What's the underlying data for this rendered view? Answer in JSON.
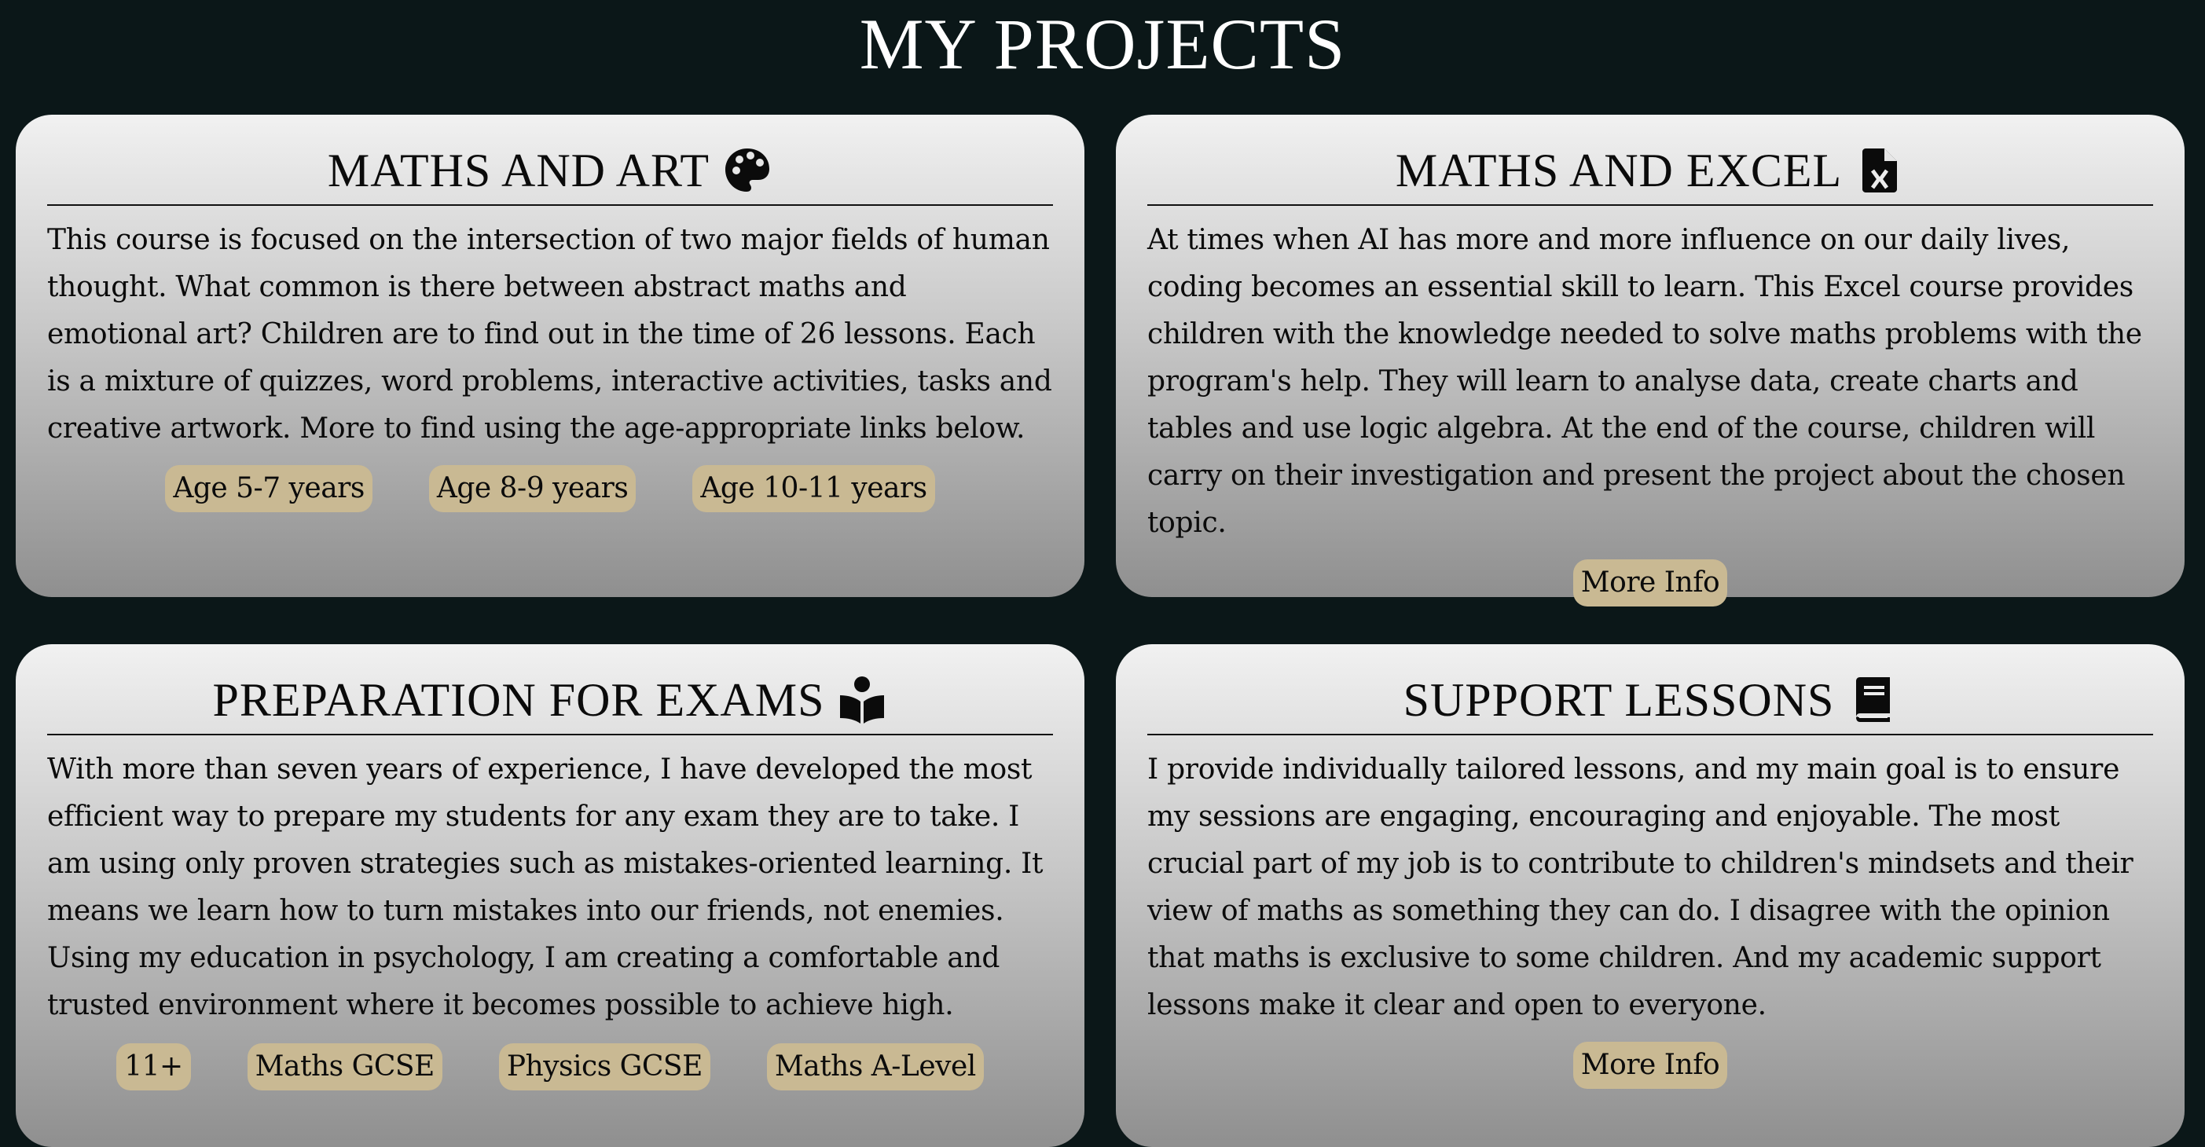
{
  "page": {
    "title": "MY PROJECTS"
  },
  "cards": [
    {
      "title": "MATHS AND ART",
      "icon": "palette-icon",
      "text": "This course is focused on the intersection of two major fields of human thought. What common is there between abstract maths and emotional art? Children are to find out in the time of 26 lessons. Each is a mixture of quizzes, word problems, interactive activities, tasks and creative artwork. More to find using the age-appropriate links below.",
      "buttons": [
        "Age 5-7 years",
        "Age 8-9 years",
        "Age 10-11 years"
      ]
    },
    {
      "title": "MATHS AND EXCEL",
      "icon": "excel-file-icon",
      "text": "At times when AI has more and more influence on our daily lives, coding becomes an essential skill to learn. This Excel course provides children with the knowledge needed to solve maths problems with the program's help. They will learn to analyse data, create charts and tables and use logic algebra. At the end of the course, children will carry on their investigation and present the project about the chosen topic.",
      "buttons": [
        "More Info"
      ]
    },
    {
      "title": "PREPARATION FOR EXAMS",
      "icon": "book-reader-icon",
      "text": "With more than seven years of experience, I have developed the most efficient way to prepare my students for any exam they are to take. I am using only proven strategies such as mistakes-oriented learning. It means we learn how to turn mistakes into our friends, not enemies. Using my education in psychology, I am creating a comfortable and trusted environment where it becomes possible to achieve high.",
      "buttons": [
        "11+",
        "Maths GCSE",
        "Physics GCSE",
        "Maths A-Level"
      ]
    },
    {
      "title": "SUPPORT LESSONS",
      "icon": "book-icon",
      "text": "I provide individually tailored lessons, and my main goal is to ensure my sessions are engaging, encouraging and enjoyable. The most crucial part of my job is to contribute to children's mindsets and their view of maths as something they can do. I disagree with the opinion that maths is exclusive to some children. And my academic support lessons make it clear and open to everyone.",
      "buttons": [
        "More Info"
      ]
    }
  ],
  "colors": {
    "background": "#0b1718",
    "button": "#c9b993",
    "title": "#ffffff"
  }
}
